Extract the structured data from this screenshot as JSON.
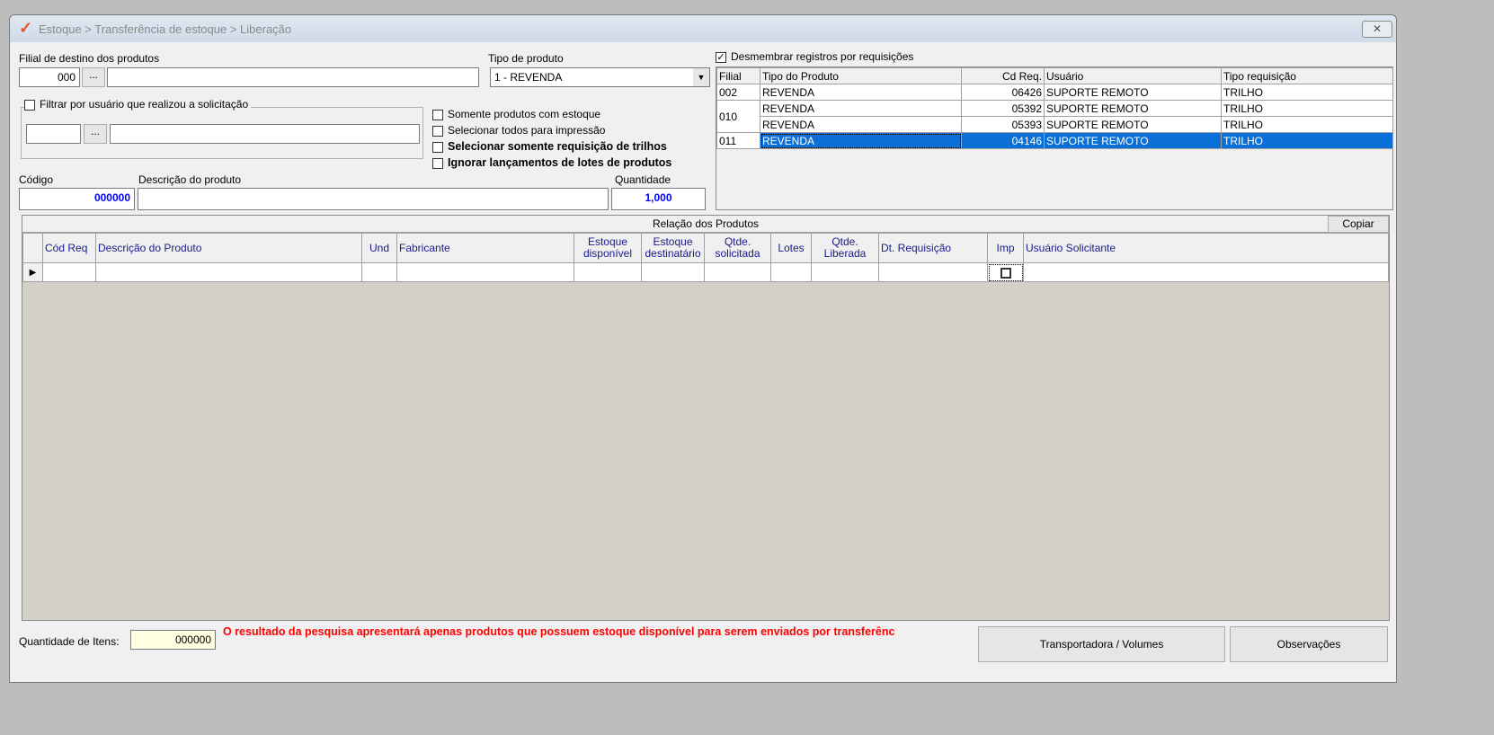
{
  "window": {
    "title": "Estoque > Transferência de estoque > Liberação",
    "close": "✕"
  },
  "filial": {
    "label": "Filial de destino dos produtos",
    "code": "000",
    "browse": "...",
    "name": ""
  },
  "tipo_produto": {
    "label": "Tipo de produto",
    "value": "1 - REVENDA"
  },
  "filtrar_usuario": {
    "label": "Filtrar por usuário que realizou a solicitação",
    "checked": false,
    "browse": "..."
  },
  "options": [
    {
      "label": "Somente produtos com estoque",
      "bold": false
    },
    {
      "label": "Selecionar todos para impressão",
      "bold": false
    },
    {
      "label": "Selecionar somente requisição de trilhos",
      "bold": true
    },
    {
      "label": "Ignorar lançamentos de lotes de produtos",
      "bold": true
    }
  ],
  "codigo": {
    "label": "Código",
    "value": "000000"
  },
  "descricao": {
    "label": "Descrição do produto",
    "value": ""
  },
  "quantidade": {
    "label": "Quantidade",
    "value": "1,000"
  },
  "desmembrar": {
    "label": "Desmembrar registros por requisições",
    "checked": true
  },
  "req_grid": {
    "headers": [
      "Filial",
      "Tipo do Produto",
      "Cd Req.",
      "Usuário",
      "Tipo requisição"
    ],
    "rows": [
      {
        "filial": "002",
        "tipo": "REVENDA",
        "cd": "06426",
        "usuario": "SUPORTE REMOTO",
        "treq": "TRILHO"
      },
      {
        "filial": "010",
        "tipo": "REVENDA",
        "cd": "05392",
        "usuario": "SUPORTE REMOTO",
        "treq": "TRILHO"
      },
      {
        "filial": "",
        "tipo": "REVENDA",
        "cd": "05393",
        "usuario": "SUPORTE REMOTO",
        "treq": "TRILHO"
      },
      {
        "filial": "011",
        "tipo": "REVENDA",
        "cd": "04146",
        "usuario": "SUPORTE REMOTO",
        "treq": "TRILHO"
      }
    ]
  },
  "produtos": {
    "title": "Relação dos Produtos",
    "copiar": "Copiar",
    "headers": [
      "Cód Req",
      "Descrição do Produto",
      "Und",
      "Fabricante",
      "Estoque disponível",
      "Estoque destinatário",
      "Qtde. solicitada",
      "Lotes",
      "Qtde. Liberada",
      "Dt. Requisição",
      "Imp",
      "Usuário Solicitante"
    ]
  },
  "footer": {
    "qtd_label": "Quantidade de Itens:",
    "qtd_value": "000000",
    "message": "O resultado da pesquisa apresentará apenas produtos que possuem estoque disponível para serem enviados por transferênc",
    "transportadora": "Transportadora / Volumes",
    "observacoes": "Observações"
  }
}
